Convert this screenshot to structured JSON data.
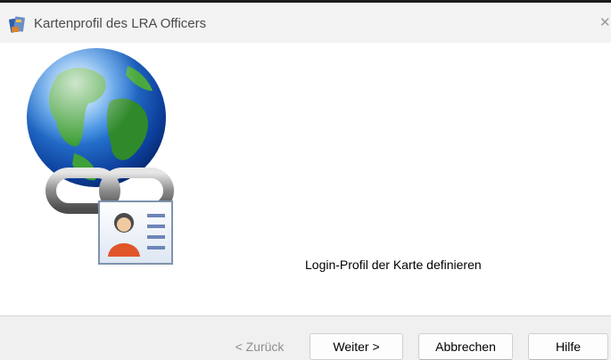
{
  "window": {
    "title": "Kartenprofil des LRA Officers",
    "close_glyph": "✕",
    "icon": "card-wizard-icon"
  },
  "content": {
    "illustration": "globe-chain-id-card",
    "message": "Login-Profil der Karte definieren"
  },
  "buttons": {
    "back": "< Zurück",
    "next": "Weiter >",
    "cancel": "Abbrechen",
    "help": "Hilfe"
  },
  "colors": {
    "titlebar": "#f3f3f3",
    "footer": "#f0f0f0",
    "globe_ocean": "#1e63c4",
    "globe_land": "#3a9a2e",
    "avatar": "#e0552a"
  }
}
